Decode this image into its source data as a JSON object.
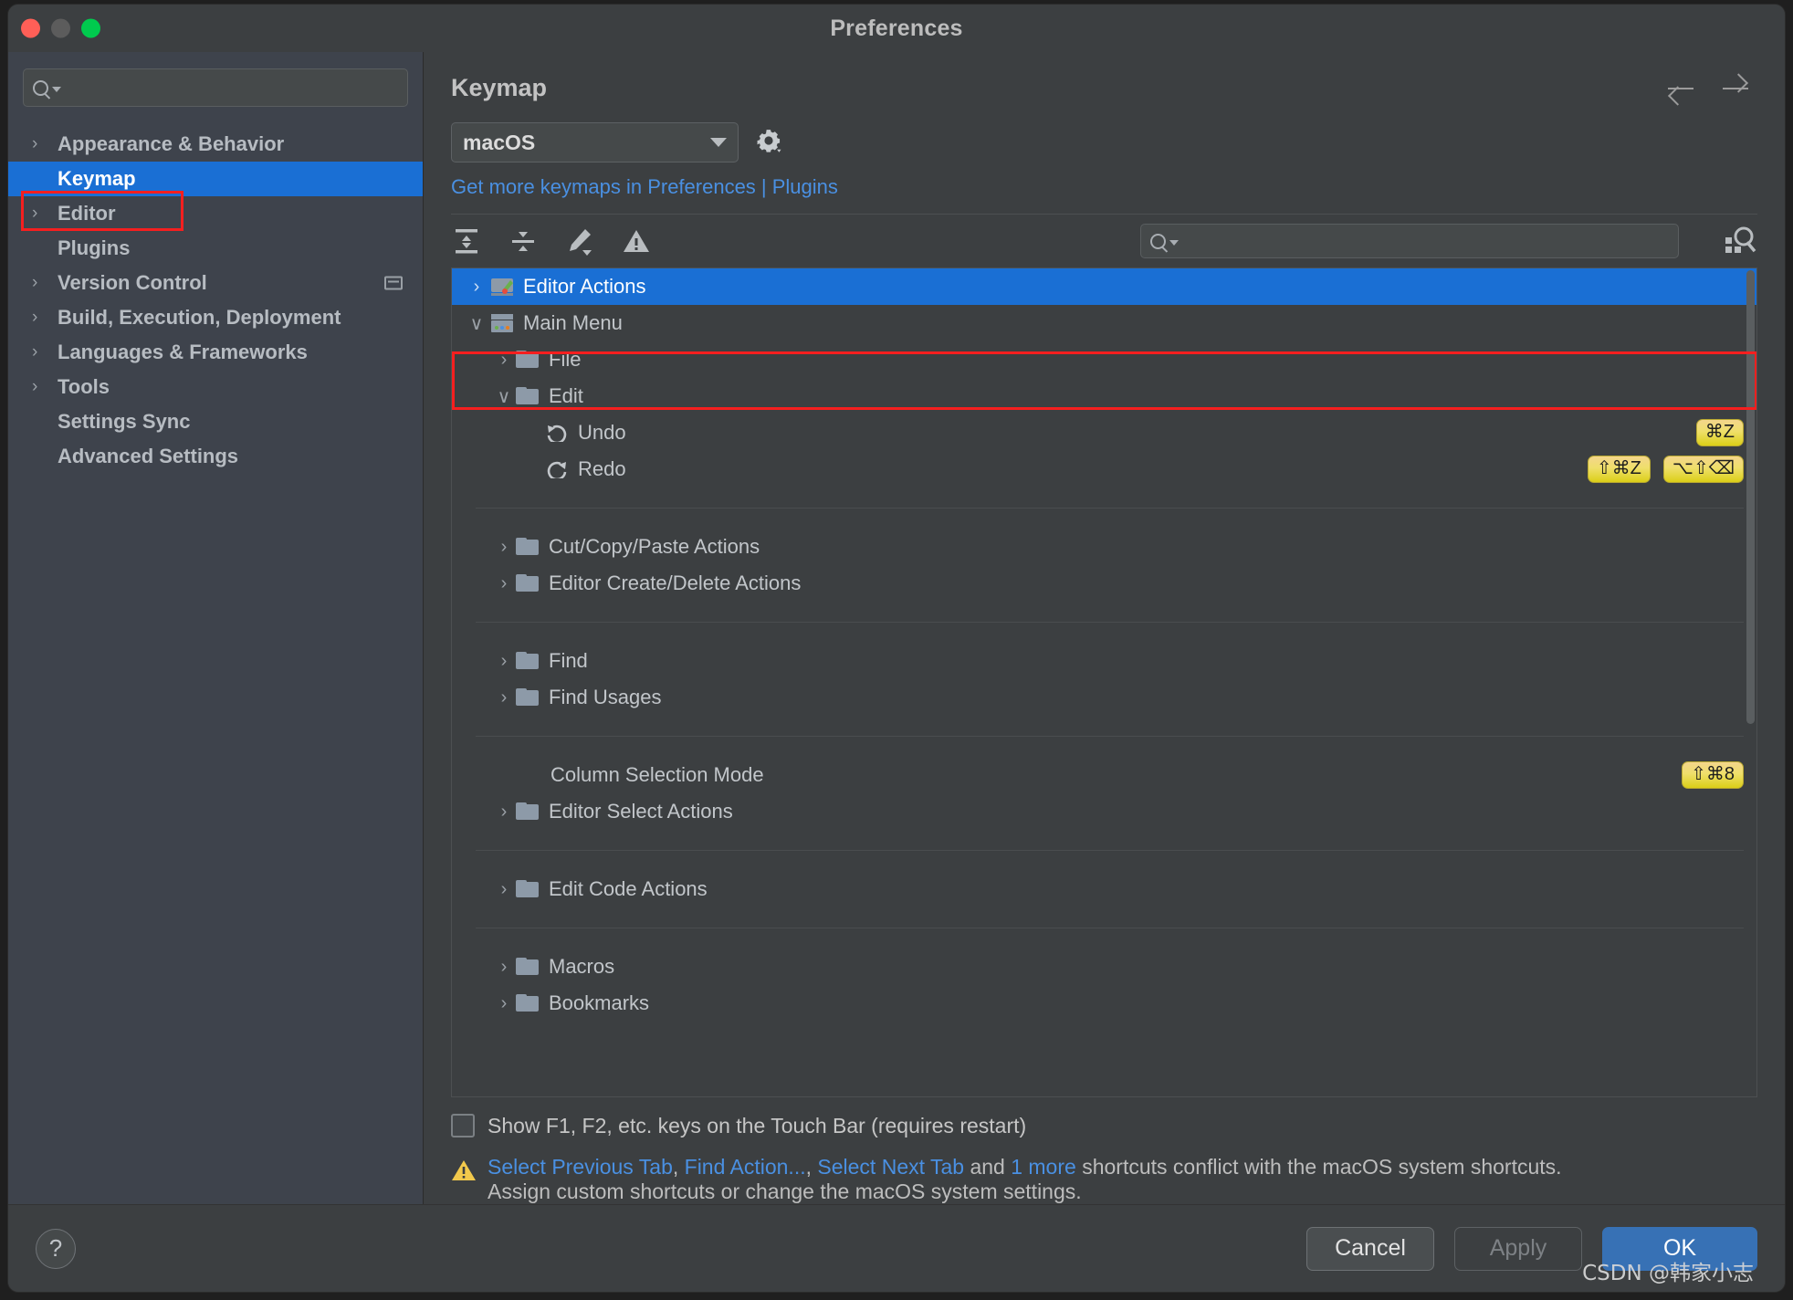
{
  "window": {
    "title": "Preferences",
    "traffic_lights": [
      "close",
      "minimize",
      "zoom"
    ]
  },
  "sidebar": {
    "search": {
      "placeholder": "",
      "value": ""
    },
    "items": [
      {
        "label": "Appearance & Behavior",
        "expandable": true,
        "selected": false,
        "end_icon": ""
      },
      {
        "label": "Keymap",
        "expandable": false,
        "selected": true,
        "end_icon": ""
      },
      {
        "label": "Editor",
        "expandable": true,
        "selected": false,
        "end_icon": ""
      },
      {
        "label": "Plugins",
        "expandable": false,
        "selected": false,
        "end_icon": ""
      },
      {
        "label": "Version Control",
        "expandable": true,
        "selected": false,
        "end_icon": "window-icon"
      },
      {
        "label": "Build, Execution, Deployment",
        "expandable": true,
        "selected": false,
        "end_icon": ""
      },
      {
        "label": "Languages & Frameworks",
        "expandable": true,
        "selected": false,
        "end_icon": ""
      },
      {
        "label": "Tools",
        "expandable": true,
        "selected": false,
        "end_icon": ""
      },
      {
        "label": "Settings Sync",
        "expandable": false,
        "selected": false,
        "end_icon": ""
      },
      {
        "label": "Advanced Settings",
        "expandable": false,
        "selected": false,
        "end_icon": ""
      }
    ]
  },
  "main": {
    "page_title": "Keymap",
    "keymap_select": {
      "value": "macOS"
    },
    "plugins_link": "Get more keymaps in Preferences | Plugins",
    "toolbar": {
      "icons": [
        "expand-all-icon",
        "collapse-all-icon",
        "edit-shortcut-icon",
        "show-conflicts-icon"
      ],
      "search": {
        "placeholder": "",
        "value": ""
      },
      "find_by_shortcut": "find-by-shortcut-icon"
    },
    "tree": [
      {
        "label": "Editor Actions",
        "indent": 0,
        "arrow": "collapsed",
        "icon": "editor-actions-icon",
        "selected": true,
        "shortcuts": []
      },
      {
        "label": "Main Menu",
        "indent": 0,
        "arrow": "expanded",
        "icon": "main-menu-icon",
        "selected": false,
        "shortcuts": []
      },
      {
        "label": "File",
        "indent": 1,
        "arrow": "collapsed",
        "icon": "folder",
        "selected": false,
        "shortcuts": []
      },
      {
        "label": "Edit",
        "indent": 1,
        "arrow": "expanded",
        "icon": "folder",
        "selected": false,
        "shortcuts": []
      },
      {
        "label": "Undo",
        "indent": 2,
        "arrow": "none",
        "icon": "undo-icon",
        "selected": false,
        "shortcuts": [
          "⌘Z"
        ]
      },
      {
        "label": "Redo",
        "indent": 2,
        "arrow": "none",
        "icon": "redo-icon",
        "selected": false,
        "shortcuts": [
          "⇧⌘Z",
          "⌥⇧⌫"
        ]
      },
      {
        "separator": true
      },
      {
        "label": "Cut/Copy/Paste Actions",
        "indent": 1,
        "arrow": "collapsed",
        "icon": "folder",
        "selected": false,
        "shortcuts": []
      },
      {
        "label": "Editor Create/Delete Actions",
        "indent": 1,
        "arrow": "collapsed",
        "icon": "folder",
        "selected": false,
        "shortcuts": []
      },
      {
        "separator": true
      },
      {
        "label": "Find",
        "indent": 1,
        "arrow": "collapsed",
        "icon": "folder",
        "selected": false,
        "shortcuts": []
      },
      {
        "label": "Find Usages",
        "indent": 1,
        "arrow": "collapsed",
        "icon": "folder",
        "selected": false,
        "shortcuts": []
      },
      {
        "separator": true
      },
      {
        "label": "Column Selection Mode",
        "indent": 1,
        "arrow": "none",
        "icon": "none",
        "selected": false,
        "shortcuts": [
          "⇧⌘8"
        ]
      },
      {
        "label": "Editor Select Actions",
        "indent": 1,
        "arrow": "collapsed",
        "icon": "folder",
        "selected": false,
        "shortcuts": []
      },
      {
        "separator": true
      },
      {
        "label": "Edit Code Actions",
        "indent": 1,
        "arrow": "collapsed",
        "icon": "folder",
        "selected": false,
        "shortcuts": []
      },
      {
        "separator": true
      },
      {
        "label": "Macros",
        "indent": 1,
        "arrow": "collapsed",
        "icon": "folder",
        "selected": false,
        "shortcuts": []
      },
      {
        "label": "Bookmarks",
        "indent": 1,
        "arrow": "collapsed",
        "icon": "folder",
        "selected": false,
        "shortcuts": []
      }
    ],
    "touchbar_checkbox": {
      "label": "Show F1, F2, etc. keys on the Touch Bar (requires restart)",
      "checked": false
    },
    "conflict_warning": {
      "links": [
        "Select Previous Tab",
        "Find Action...",
        "Select Next Tab",
        "1 more"
      ],
      "text_sep1": ", ",
      "text_sep2": ", ",
      "text_and": " and ",
      "text_tail": " shortcuts conflict with the macOS system shortcuts.",
      "line2": "Assign custom shortcuts or change the macOS system settings."
    }
  },
  "footer": {
    "help": "?",
    "cancel": "Cancel",
    "apply": "Apply",
    "ok": "OK",
    "watermark": "CSDN @韩家小志"
  },
  "colors": {
    "accent_blue": "#1a6fd4",
    "link_blue": "#4a90e2",
    "ok_button": "#3771b5",
    "annotation_red": "#f51f1f",
    "badge_yellow": "#dbcf18"
  }
}
